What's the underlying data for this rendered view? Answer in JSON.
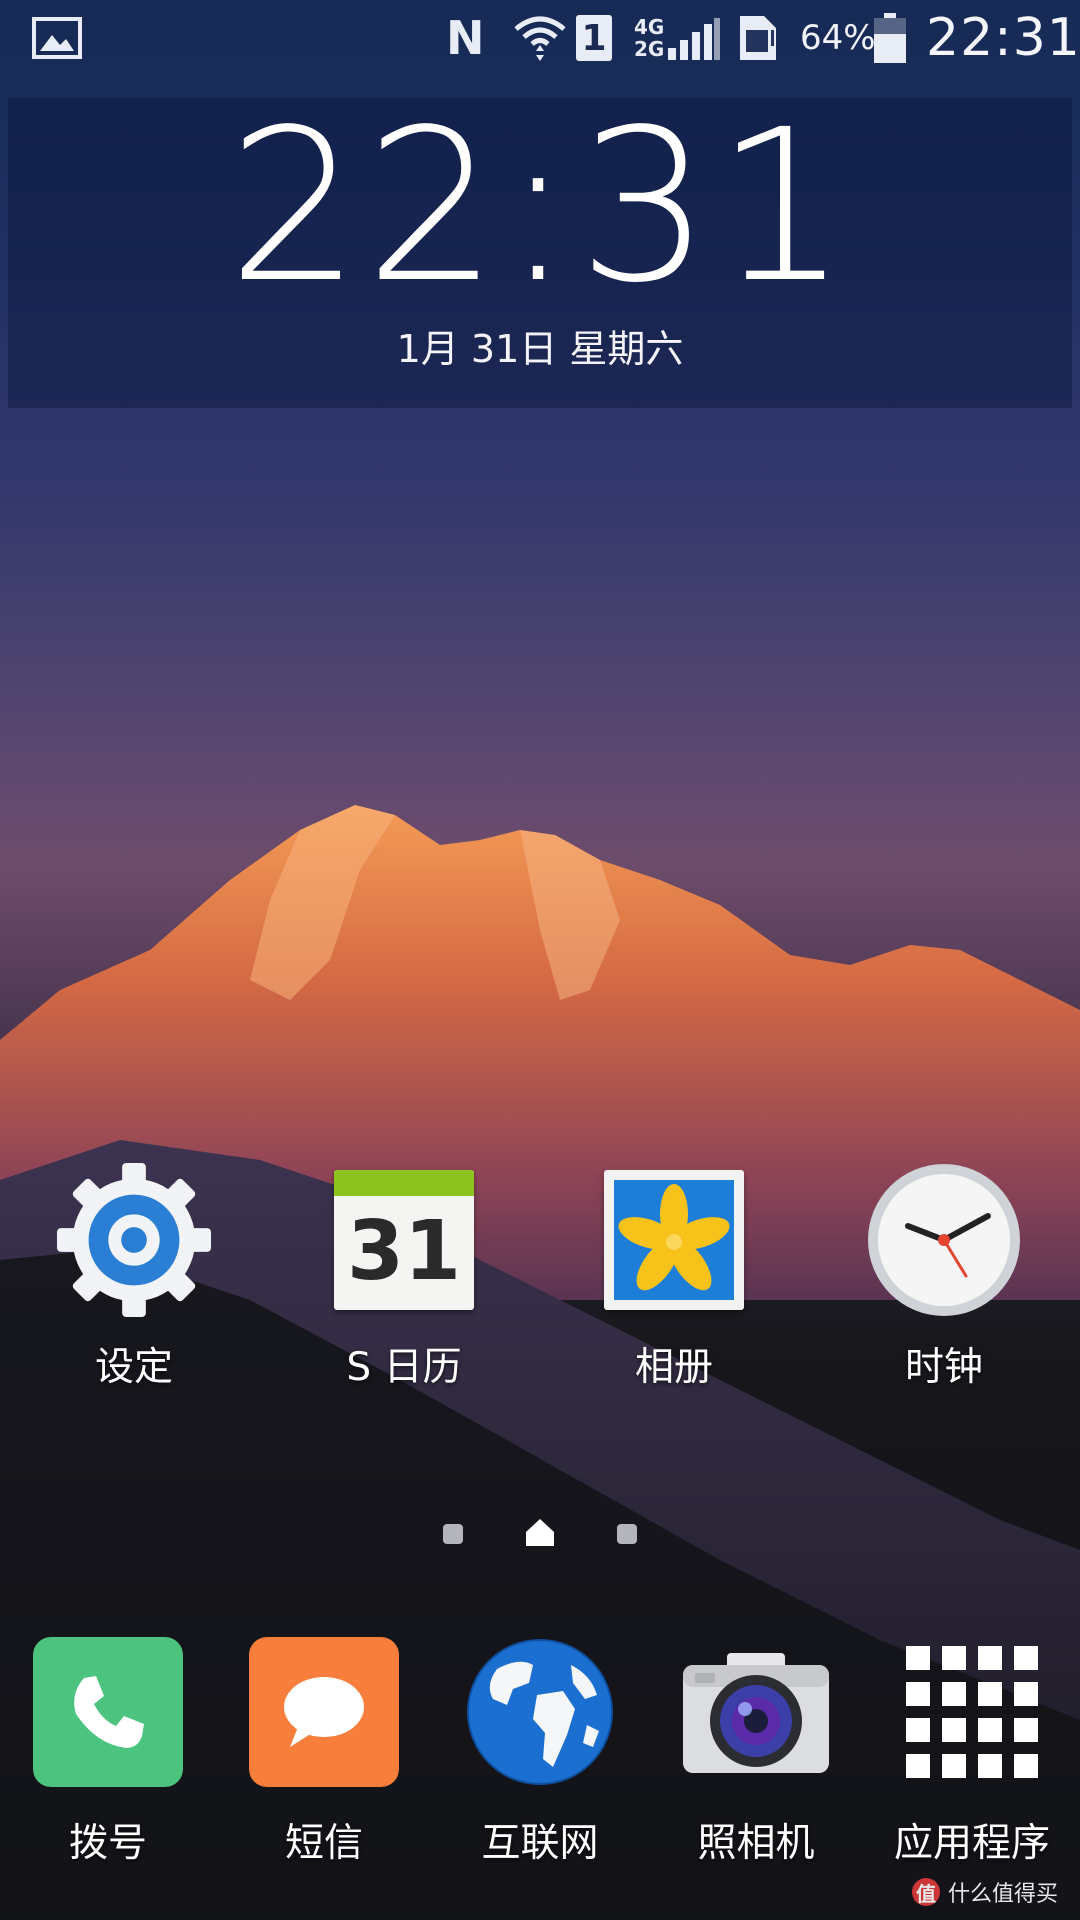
{
  "status_bar": {
    "left_icon": "image-notification-icon",
    "nfc_label": "N",
    "sim_slot": "1",
    "network_top": "4G",
    "network_bottom": "2G",
    "battery_percent": "64%",
    "battery_level": 0.64,
    "time": "22:31",
    "icons": [
      "image-notification-icon",
      "nfc-icon",
      "wifi-icon",
      "sim-slot-icon",
      "signal-icon",
      "sim-card-alert-icon",
      "battery-icon"
    ]
  },
  "clock_widget": {
    "time": "22:31",
    "date": "1月 31日 星期六"
  },
  "home_apps": [
    {
      "label": "设定",
      "icon": "settings-gear-icon"
    },
    {
      "label": "S 日历",
      "icon": "calendar-icon",
      "day": "31"
    },
    {
      "label": "相册",
      "icon": "gallery-icon"
    },
    {
      "label": "时钟",
      "icon": "clock-icon"
    }
  ],
  "pager": {
    "pages": 3,
    "current": "home",
    "current_index": 1
  },
  "dock": [
    {
      "label": "拨号",
      "icon": "phone-icon",
      "color": "#4cc47f"
    },
    {
      "label": "短信",
      "icon": "message-icon",
      "color": "#f77f3b"
    },
    {
      "label": "互联网",
      "icon": "globe-icon"
    },
    {
      "label": "照相机",
      "icon": "camera-icon"
    },
    {
      "label": "应用程序",
      "icon": "apps-grid-icon"
    }
  ],
  "watermark": {
    "text": "什么值得买",
    "badge": "值"
  }
}
